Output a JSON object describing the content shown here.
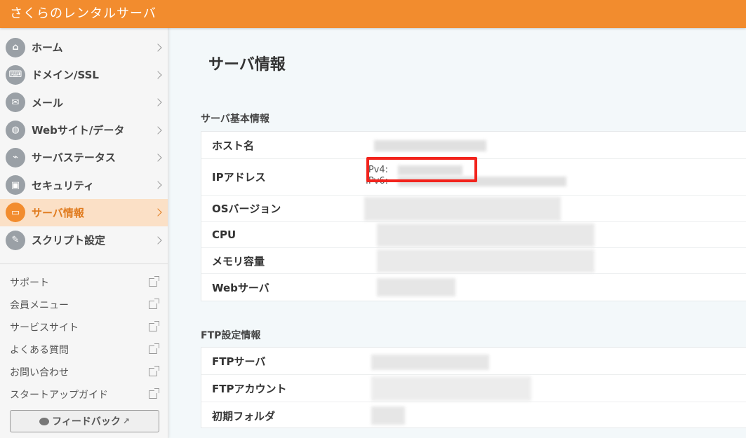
{
  "app": {
    "title": "さくらのレンタルサーバ"
  },
  "sidebar": {
    "nav": [
      {
        "label": "ホーム",
        "icon": "home-icon",
        "glyph": "⌂"
      },
      {
        "label": "ドメイン/SSL",
        "icon": "domain-icon",
        "glyph": "⌨"
      },
      {
        "label": "メール",
        "icon": "mail-icon",
        "glyph": "✉"
      },
      {
        "label": "Webサイト/データ",
        "icon": "globe-icon",
        "glyph": "◍"
      },
      {
        "label": "サーバステータス",
        "icon": "chart-icon",
        "glyph": "⌁"
      },
      {
        "label": "セキュリティ",
        "icon": "lock-icon",
        "glyph": "▣"
      },
      {
        "label": "サーバ情報",
        "icon": "server-icon",
        "glyph": "▭",
        "active": true
      },
      {
        "label": "スクリプト設定",
        "icon": "script-icon",
        "glyph": "✎"
      }
    ],
    "links": [
      {
        "label": "サポート"
      },
      {
        "label": "会員メニュー"
      },
      {
        "label": "サービスサイト"
      },
      {
        "label": "よくある質問"
      },
      {
        "label": "お問い合わせ"
      },
      {
        "label": "スタートアップガイド"
      }
    ],
    "feedback_label": "フィードバック"
  },
  "main": {
    "title": "サーバ情報",
    "basic": {
      "title": "サーバ基本情報",
      "rows": {
        "host": "ホスト名",
        "ip": "IPアドレス",
        "os": "OSバージョン",
        "cpu": "CPU",
        "memory": "メモリ容量",
        "web": "Webサーバ"
      },
      "ipv4_label": "IPv4:",
      "ipv6_label": "IPv6:"
    },
    "ftp": {
      "title": "FTP設定情報",
      "rows": {
        "server": "FTPサーバ",
        "account": "FTPアカウント",
        "folder": "初期フォルダ"
      }
    }
  }
}
